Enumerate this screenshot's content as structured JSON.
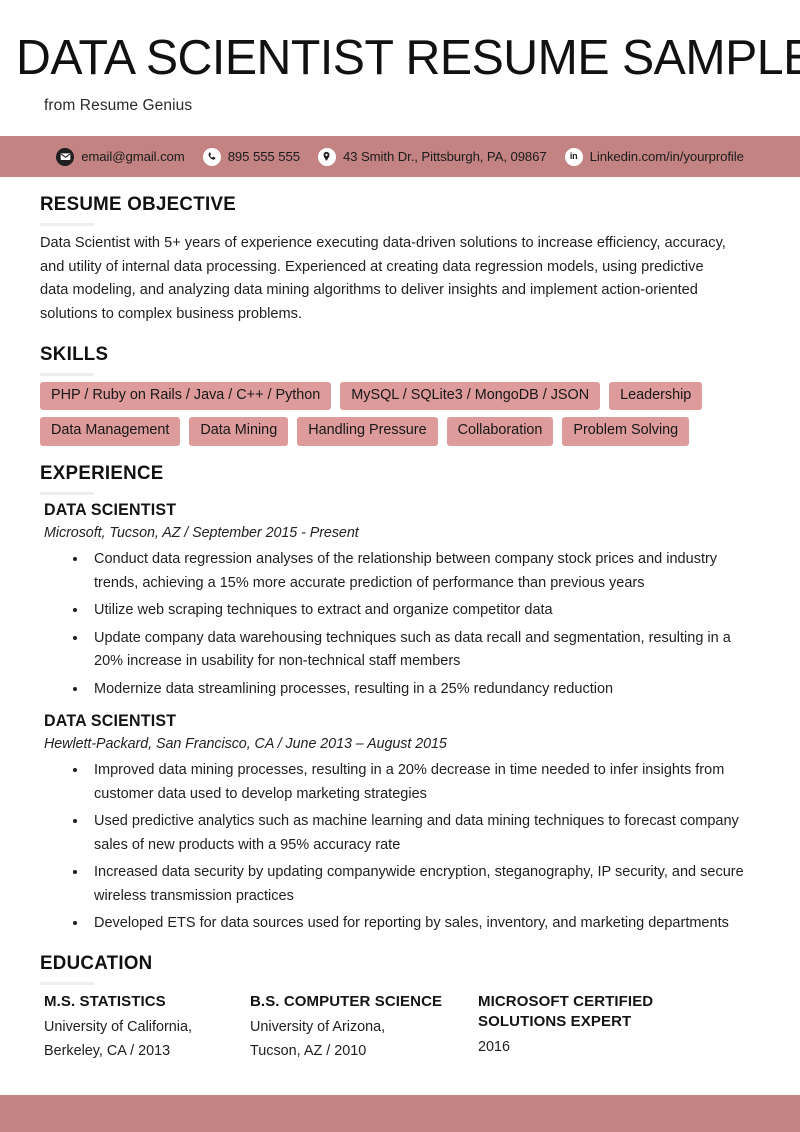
{
  "header": {
    "title": "DATA SCIENTIST RESUME SAMPLE",
    "subtitle": "from Resume Genius"
  },
  "contact": {
    "items": [
      {
        "icon": "email-icon",
        "value": "email@gmail.com"
      },
      {
        "icon": "phone-icon",
        "value": "895 555 555"
      },
      {
        "icon": "location-pin-icon",
        "value": "43 Smith Dr., Pittsburgh, PA, 09867"
      },
      {
        "icon": "linkedin-icon",
        "value": "Linkedin.com/in/yourprofile"
      }
    ]
  },
  "objective": {
    "heading": "RESUME OBJECTIVE",
    "text": "Data Scientist with 5+ years of experience executing data-driven solutions to increase efficiency, accuracy, and utility of internal data processing. Experienced at creating data regression models, using predictive data modeling, and analyzing data mining algorithms to deliver insights and implement action-oriented solutions to complex business problems."
  },
  "skills": {
    "heading": "SKILLS",
    "rows": [
      [
        "PHP / Ruby on Rails / Java / C++ / Python",
        "MySQL / SQLite3 / MongoDB / JSON",
        "Leadership"
      ],
      [
        "Data Management",
        "Data Mining",
        "Handling Pressure",
        "Collaboration",
        "Problem Solving"
      ]
    ]
  },
  "experience": {
    "heading": "EXPERIENCE",
    "jobs": [
      {
        "title": "DATA SCIENTIST",
        "meta": "Microsoft, Tucson, AZ  /  September 2015 - Present",
        "bullets": [
          "Conduct data regression analyses of the relationship between company stock prices and industry trends, achieving a 15% more accurate prediction of performance than previous years",
          "Utilize web scraping techniques to extract and organize competitor data",
          "Update company data warehousing techniques such as data recall and segmentation, resulting in a 20% increase in usability for non-technical staff members",
          "Modernize data streamlining processes, resulting in a 25% redundancy reduction"
        ]
      },
      {
        "title": "DATA SCIENTIST",
        "meta": "Hewlett-Packard, San Francisco, CA  /  June 2013 – August 2015",
        "bullets": [
          "Improved data mining processes, resulting in a 20% decrease in time needed to infer insights from customer data used to develop marketing strategies",
          "Used predictive analytics such as machine learning and data mining techniques to forecast company sales of new products with a 95% accuracy rate",
          "Increased data security by updating companywide encryption, steganography, IP security, and secure wireless transmission practices",
          "Developed ETS for data sources used for reporting by sales, inventory, and marketing departments"
        ]
      }
    ]
  },
  "education": {
    "heading": "EDUCATION",
    "entries": [
      {
        "degree": "M.S. STATISTICS",
        "line1": "University of California,",
        "line2": "Berkeley, CA  /  2013"
      },
      {
        "degree": "B.S. COMPUTER SCIENCE",
        "line1": "University of Arizona,",
        "line2": "Tucson, AZ  /  2010"
      },
      {
        "degree": "MICROSOFT CERTIFIED SOLUTIONS EXPERT",
        "line1": "2016",
        "line2": ""
      }
    ]
  },
  "colors": {
    "accent_bar": "#c48383",
    "skill_tag": "#de9b9b",
    "rule": "#eeeeee",
    "text": "#1a1a1a"
  }
}
